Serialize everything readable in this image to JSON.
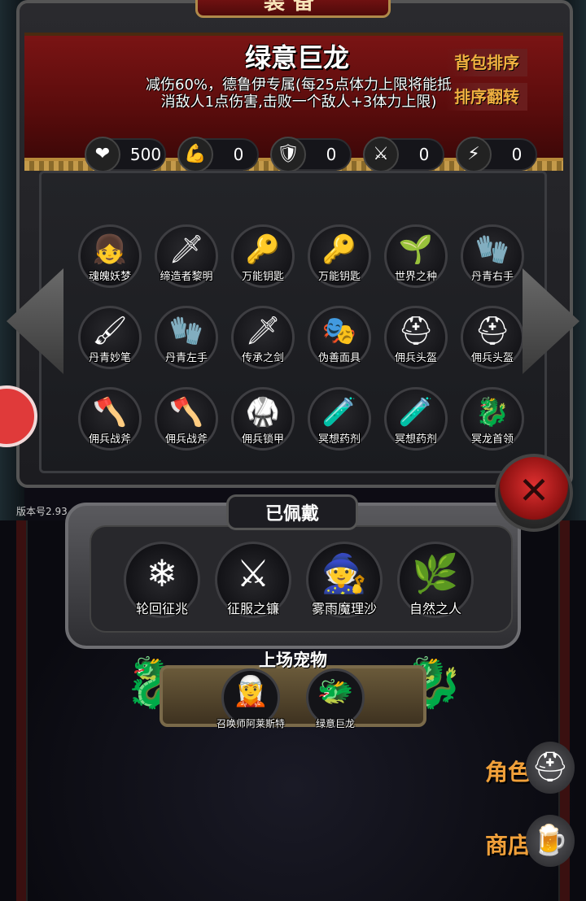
{
  "header": {
    "title": "装备"
  },
  "pet": {
    "name": "绿意巨龙",
    "description": "减伤60%，德鲁伊专属(每25点体力上限将能抵消敌人1点伤害,击败一个敌人+3体力上限)"
  },
  "buttons": {
    "sort_bag": "背包排序",
    "sort_reverse": "排序翻转"
  },
  "stats": [
    {
      "icon": "heart-icon",
      "glyph": "❤",
      "value": "500"
    },
    {
      "icon": "strength-icon",
      "glyph": "💪",
      "value": "0"
    },
    {
      "icon": "armor-icon",
      "glyph": "🛡",
      "value": "0"
    },
    {
      "icon": "weapon-icon",
      "glyph": "⚔",
      "value": "0"
    },
    {
      "icon": "magic-icon",
      "glyph": "⚡",
      "value": "0"
    }
  ],
  "inventory": [
    {
      "label": "魂魄妖梦",
      "icon": "character-icon",
      "glyph": "👧"
    },
    {
      "label": "缔造者黎明",
      "icon": "sword-icon",
      "glyph": "🗡"
    },
    {
      "label": "万能钥匙",
      "icon": "key-icon",
      "glyph": "🔑"
    },
    {
      "label": "万能钥匙",
      "icon": "key-icon",
      "glyph": "🔑"
    },
    {
      "label": "世界之种",
      "icon": "seed-icon",
      "glyph": "🌱"
    },
    {
      "label": "丹青右手",
      "icon": "glove-icon",
      "glyph": "🧤"
    },
    {
      "label": "丹青妙笔",
      "icon": "brush-icon",
      "glyph": "🖌"
    },
    {
      "label": "丹青左手",
      "icon": "glove-icon",
      "glyph": "🧤"
    },
    {
      "label": "传承之剑",
      "icon": "sword-icon",
      "glyph": "🗡"
    },
    {
      "label": "伪善面具",
      "icon": "mask-icon",
      "glyph": "🎭"
    },
    {
      "label": "佣兵头盔",
      "icon": "helmet-icon",
      "glyph": "⛑"
    },
    {
      "label": "佣兵头盔",
      "icon": "helmet-icon",
      "glyph": "⛑"
    },
    {
      "label": "佣兵战斧",
      "icon": "axe-icon",
      "glyph": "🪓"
    },
    {
      "label": "佣兵战斧",
      "icon": "axe-icon",
      "glyph": "🪓"
    },
    {
      "label": "佣兵锁甲",
      "icon": "chainmail-icon",
      "glyph": "🥋"
    },
    {
      "label": "冥想药剂",
      "icon": "potion-icon",
      "glyph": "🧪"
    },
    {
      "label": "冥想药剂",
      "icon": "potion-icon",
      "glyph": "🧪"
    },
    {
      "label": "冥龙首领",
      "icon": "bone-dragon-icon",
      "glyph": "🐉"
    }
  ],
  "version": "版本号2.93",
  "equipped": {
    "title": "已佩戴",
    "items": [
      {
        "label": "轮回征兆",
        "icon": "ice-staff-icon",
        "glyph": "❄"
      },
      {
        "label": "征服之镰",
        "icon": "scythe-icon",
        "glyph": "⚔"
      },
      {
        "label": "雾雨魔理沙",
        "icon": "witch-icon",
        "glyph": "🧙"
      },
      {
        "label": "自然之人",
        "icon": "nature-man-icon",
        "glyph": "🌿"
      }
    ]
  },
  "pets": {
    "title": "上场宠物",
    "items": [
      {
        "label": "召唤师阿莱斯特",
        "icon": "summoner-icon",
        "glyph": "🧝"
      },
      {
        "label": "绿意巨龙",
        "icon": "green-dragon-icon",
        "glyph": "🐲"
      }
    ]
  },
  "nav": {
    "character": "角色",
    "shop": "商店"
  },
  "colors": {
    "accent": "#f0a03a",
    "close": "#d03030"
  }
}
